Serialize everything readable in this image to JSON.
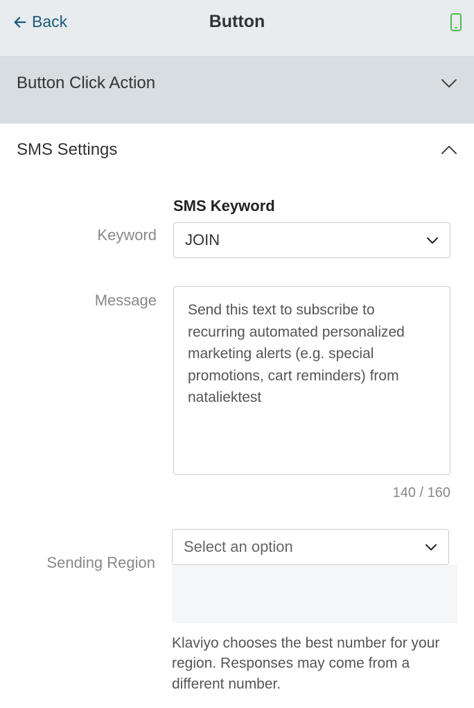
{
  "header": {
    "back_label": "Back",
    "title": "Button"
  },
  "sections": {
    "click_action": {
      "title": "Button Click Action"
    },
    "sms_settings": {
      "title": "SMS Settings",
      "keyword": {
        "label": "Keyword",
        "sub_label": "SMS Keyword",
        "value": "JOIN"
      },
      "message": {
        "label": "Message",
        "value": "Send this text to subscribe to recurring automated personalized marketing alerts (e.g. special promotions, cart reminders) from nataliektest",
        "char_count": "140 / 160"
      },
      "sending_region": {
        "label": "Sending Region",
        "placeholder": "Select an option",
        "help_text": "Klaviyo chooses the best number for your region. Responses may come from a different number."
      }
    }
  }
}
